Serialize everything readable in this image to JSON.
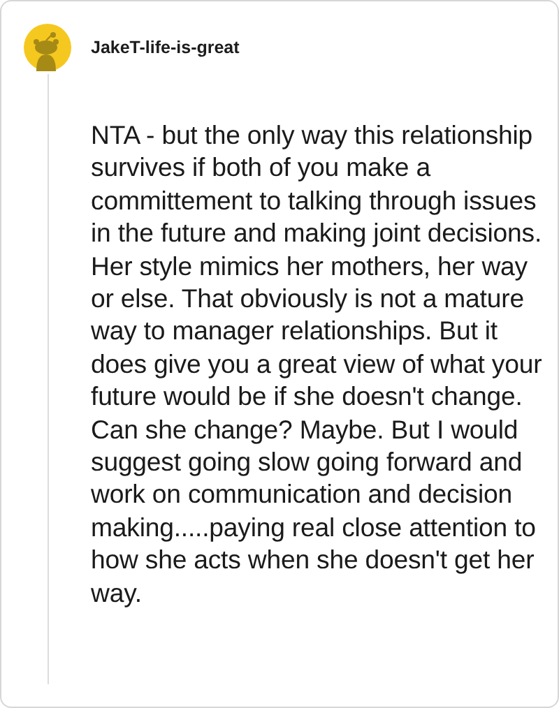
{
  "comment": {
    "author": "JakeT-life-is-great",
    "body": "NTA - but the only way this relationship survives if both of you make a committement to talking through issues in the future and making joint decisions. Her style mimics her mothers, her way or else. That obviously is not a mature way to manager relationships. But it does give you a great view of what your future would be if she doesn't change. Can she change? Maybe. But I would suggest going slow going forward and work on communication and decision making.....paying real close attention to how she acts when she doesn't get her way."
  }
}
